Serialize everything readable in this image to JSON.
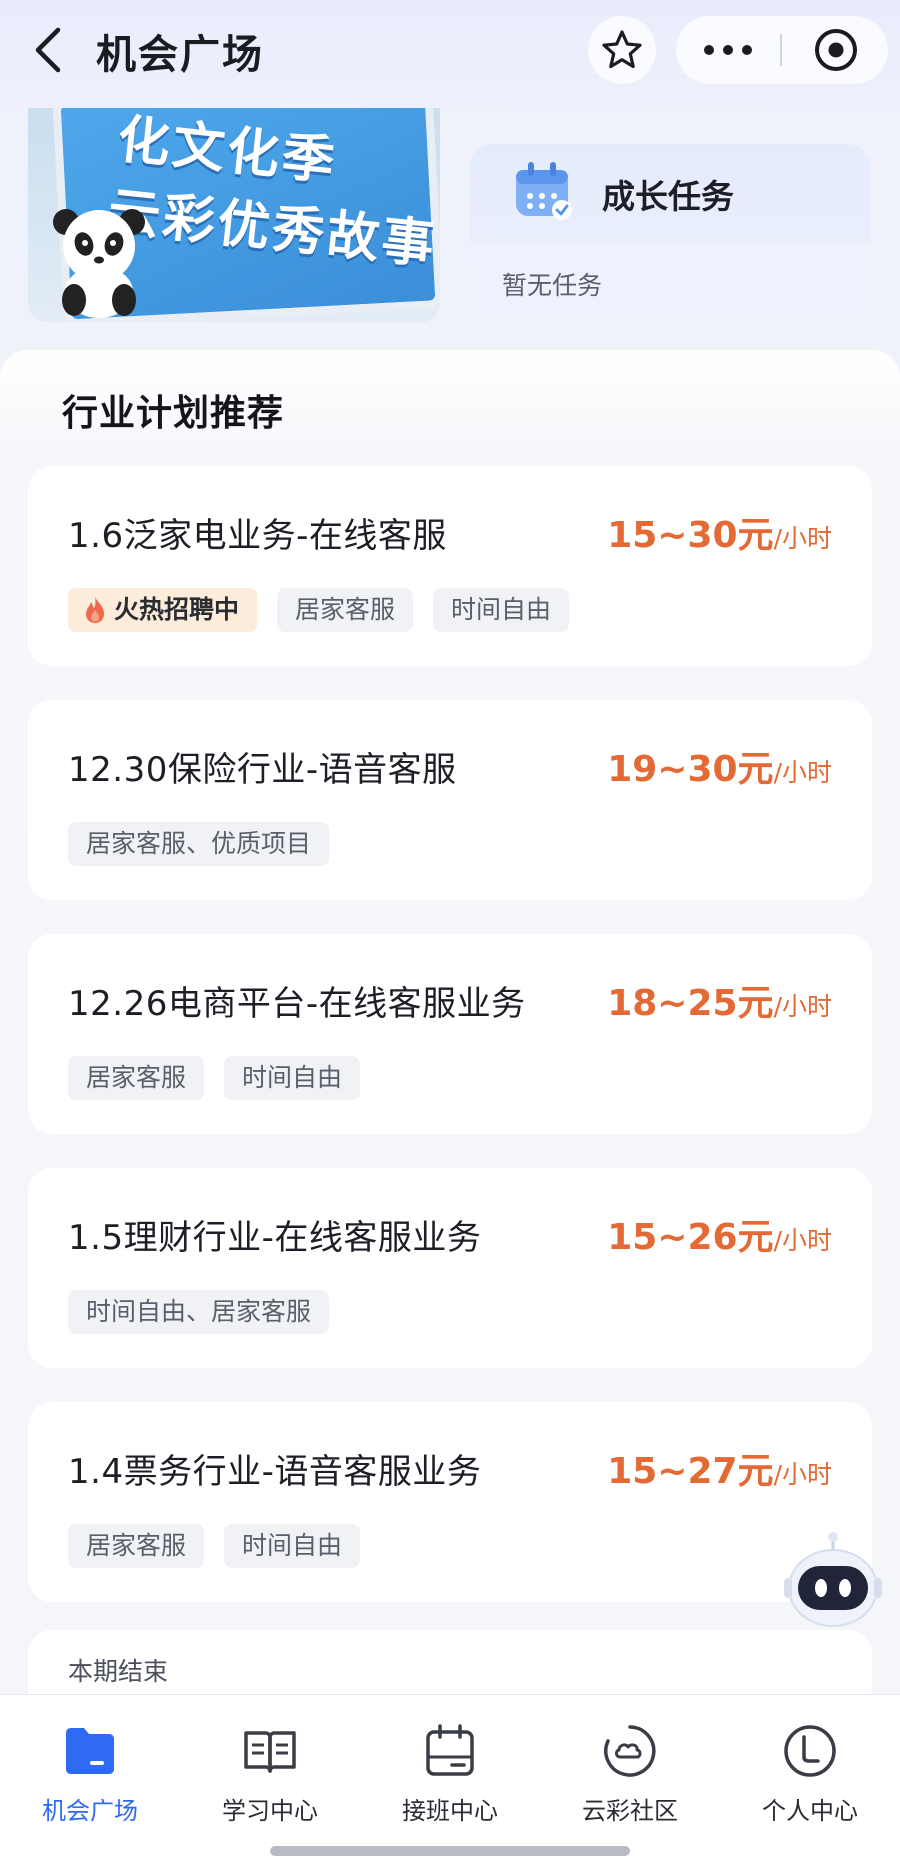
{
  "header": {
    "title": "机会广场",
    "icons": {
      "back": "chevron-left-icon",
      "favorite": "star-icon",
      "more": "more-dots-icon",
      "target": "target-icon"
    }
  },
  "banner": {
    "lines": [
      "化文化季",
      "云彩优秀故事"
    ]
  },
  "growth_task": {
    "title": "成长任务",
    "empty_text": "暂无任务"
  },
  "section": {
    "title": "行业计划推荐"
  },
  "jobs": [
    {
      "title": "1.6泛家电业务-在线客服",
      "salary": "15~30元",
      "unit": "/小时",
      "hot_tag": "火热招聘中",
      "tags": [
        "居家客服",
        "时间自由"
      ]
    },
    {
      "title": "12.30保险行业-语音客服",
      "salary": "19~30元",
      "unit": "/小时",
      "tags": [
        "居家客服、优质项目"
      ]
    },
    {
      "title": "12.26电商平台-在线客服业务",
      "salary": "18~25元",
      "unit": "/小时",
      "tags": [
        "居家客服",
        "时间自由"
      ]
    },
    {
      "title": "1.5理财行业-在线客服业务",
      "salary": "15~26元",
      "unit": "/小时",
      "tags": [
        "时间自由、居家客服"
      ]
    },
    {
      "title": "1.4票务行业-语音客服业务",
      "salary": "15~27元",
      "unit": "/小时",
      "tags": [
        "居家客服",
        "时间自由"
      ]
    }
  ],
  "footer_note": "本期结束",
  "tabbar": {
    "tabs": [
      {
        "label": "机会广场",
        "icon": "folder-icon",
        "active": true
      },
      {
        "label": "学习中心",
        "icon": "open-book-icon",
        "active": false
      },
      {
        "label": "接班中心",
        "icon": "calendar-icon",
        "active": false
      },
      {
        "label": "云彩社区",
        "icon": "cloud-circle-icon",
        "active": false
      },
      {
        "label": "个人中心",
        "icon": "user-circle-icon",
        "active": false
      }
    ]
  },
  "colors": {
    "accent": "#2f6bf2",
    "salary": "#e46a35",
    "hot_tag_bg": "#fdecd9"
  }
}
